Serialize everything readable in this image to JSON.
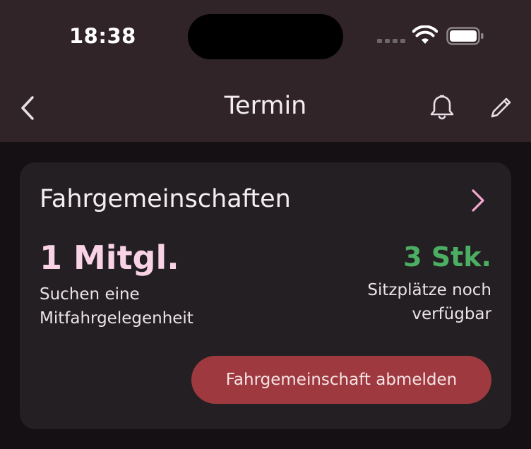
{
  "status_bar": {
    "time": "18:38",
    "icons": [
      "signal-icon",
      "wifi-icon",
      "battery-icon"
    ]
  },
  "nav": {
    "title": "Termin",
    "back_icon": "chevron-left-icon",
    "bell_icon": "bell-icon",
    "edit_icon": "pencil-icon"
  },
  "card": {
    "title": "Fahrgemeinschaften",
    "chevron_icon": "chevron-right-icon",
    "members": {
      "count": "1 Mitgl.",
      "label": "Suchen eine Mitfahrgelegenheit"
    },
    "seats": {
      "count": "3 Stk.",
      "label": "Sitzplätze noch verfügbar"
    },
    "button_label": "Fahrgemeinschaft abmelden"
  },
  "colors": {
    "topbar_bg": "#302429",
    "page_bg": "#141013",
    "card_bg": "#231f22",
    "accent_pink": "#f8d3e6",
    "chevron_pink": "#f2a7cf",
    "seats_green": "#4cae62",
    "button_red": "#9e3a3f"
  }
}
